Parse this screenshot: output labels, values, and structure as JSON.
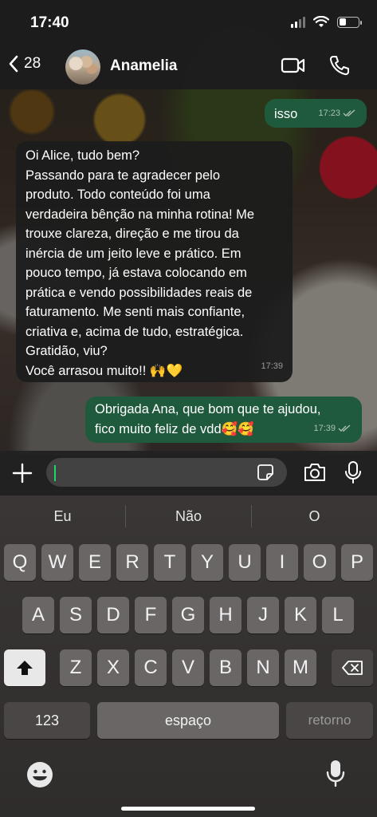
{
  "status_bar": {
    "time": "17:40"
  },
  "header": {
    "back_count": "28",
    "contact_name": "Anamelia"
  },
  "messages": [
    {
      "direction": "out",
      "text": "isso",
      "time": "17:23"
    },
    {
      "direction": "in",
      "lines": [
        "Oi Alice, tudo bem?",
        "Passando para te agradecer pelo",
        "produto. Todo conteúdo foi uma",
        "verdadeira bênção na minha rotina! Me",
        "trouxe clareza, direção e me tirou da",
        "inércia de um jeito leve e prático. Em",
        "pouco tempo, já estava colocando em",
        "prática e vendo possibilidades reais de",
        "faturamento. Me senti mais confiante,",
        "criativa e, acima de tudo, estratégica.",
        "Gratidão, viu?",
        "Você arrasou muito!! 🙌💛"
      ],
      "time": "17:39"
    },
    {
      "direction": "out",
      "lines": [
        "Obrigada Ana, que bom que te ajudou,",
        "fico muito feliz de vdd🥰🥰"
      ],
      "time": "17:39"
    }
  ],
  "input": {
    "placeholder": ""
  },
  "keyboard": {
    "suggestions": [
      "Eu",
      "Não",
      "O"
    ],
    "row1": [
      "Q",
      "W",
      "E",
      "R",
      "T",
      "Y",
      "U",
      "I",
      "O",
      "P"
    ],
    "row2": [
      "A",
      "S",
      "D",
      "F",
      "G",
      "H",
      "J",
      "K",
      "L"
    ],
    "row3": [
      "Z",
      "X",
      "C",
      "V",
      "B",
      "N",
      "M"
    ],
    "numbers_label": "123",
    "space_label": "espaço",
    "return_label": "retorno"
  },
  "colors": {
    "outgoing_bubble": "#1f5a3c",
    "incoming_bubble": "#1c1c1c",
    "caret": "#25d366"
  },
  "icons": {
    "back": "chevron-left-icon",
    "video": "video-camera-icon",
    "call": "phone-icon",
    "plus": "plus-icon",
    "sticker": "sticker-icon",
    "camera": "camera-icon",
    "mic": "microphone-icon",
    "shift": "shift-icon",
    "delete": "backspace-icon",
    "emoji": "emoji-icon",
    "dictation": "dictation-mic-icon"
  }
}
